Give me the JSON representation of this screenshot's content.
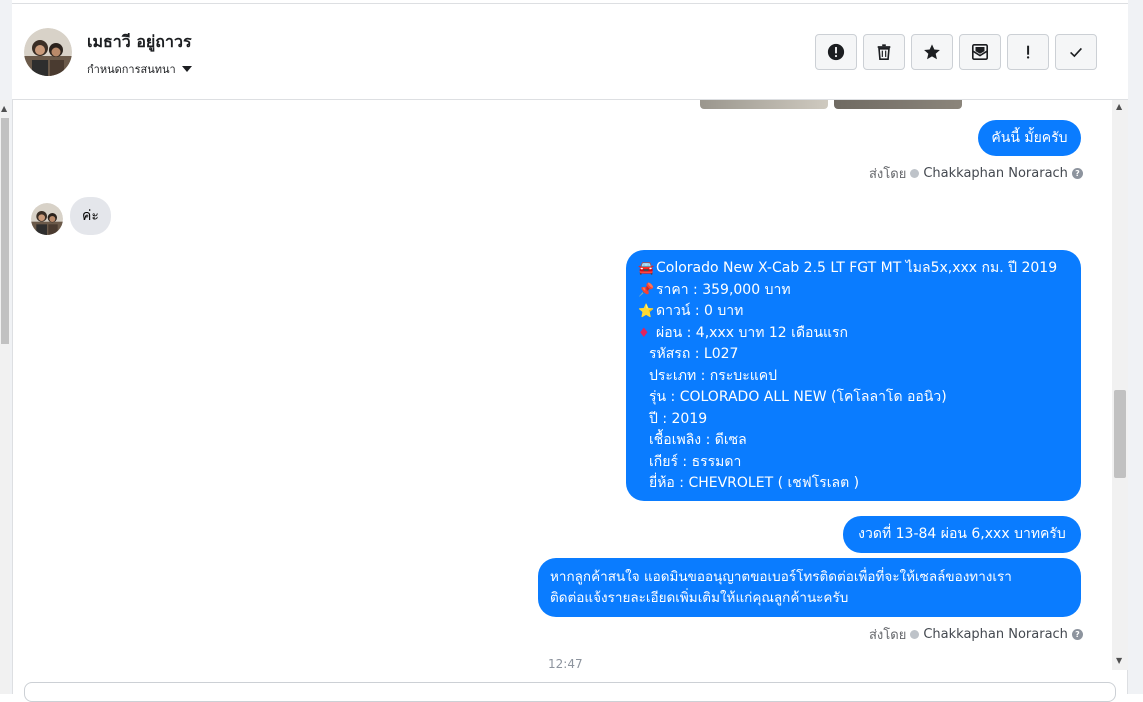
{
  "header": {
    "contact_name": "เมธาวี อยู่ถาวร",
    "assign_label": "กำหนดการสนทนา"
  },
  "toolbar": [
    {
      "name": "spam-button",
      "icon": "alert-circle-icon"
    },
    {
      "name": "delete-button",
      "icon": "trash-icon"
    },
    {
      "name": "star-button",
      "icon": "star-icon"
    },
    {
      "name": "mark-unread-button",
      "icon": "envelope-icon"
    },
    {
      "name": "follow-up-button",
      "icon": "exclamation-icon"
    },
    {
      "name": "mark-done-button",
      "icon": "check-icon"
    }
  ],
  "messages": {
    "msg1": "คันนี้ มั้ยครับ",
    "sent_by_label": "ส่งโดย",
    "sent_by_name": "Chakkaphan Norarach",
    "incoming1": "ค่ะ",
    "listing": {
      "lines": [
        {
          "emoji": "🚘",
          "text": "Colorado New X-Cab 2.5 LT FGT MT ไมล5x,xxx กม. ปี 2019"
        },
        {
          "emoji": "📌",
          "text": "ราคา : 359,000 บาท"
        },
        {
          "emoji": "⭐",
          "text": "ดาวน์ : 0 บาท"
        },
        {
          "emoji": "♦",
          "text": " ผ่อน : 4,xxx บาท 12 เดือนแรก"
        },
        {
          "emoji": "",
          "text": "รหัสรถ : L027"
        },
        {
          "emoji": "",
          "text": "ประเภท : กระบะแคป"
        },
        {
          "emoji": "",
          "text": "รุ่น : COLORADO ALL NEW (โคโลลาโด ออนิว)"
        },
        {
          "emoji": "",
          "text": "ปี : 2019"
        },
        {
          "emoji": "",
          "text": "เชื้อเพลิง : ดีเซล"
        },
        {
          "emoji": "",
          "text": "เกียร์ : ธรรมดา"
        },
        {
          "emoji": "",
          "text": "ยี่ห้อ : CHEVROLET ( เชฟโรเลต )"
        }
      ]
    },
    "installment": "งวดที่ 13-84 ผ่อน 6,xxx บาทครับ",
    "contact_request_line1": "หากลูกค้าสนใจ แอดมินขออนุญาตขอเบอร์โทรติดต่อเพื่อที่จะให้เซลล์ของทางเรา",
    "contact_request_line2": "ติดต่อแจ้งรายละเอียดเพิ่มเติมให้แก่คุณลูกค้านะครับ",
    "time": "12:47"
  },
  "colors": {
    "bubble_outgoing": "#0a7cff",
    "bubble_incoming": "#e4e6eb"
  }
}
